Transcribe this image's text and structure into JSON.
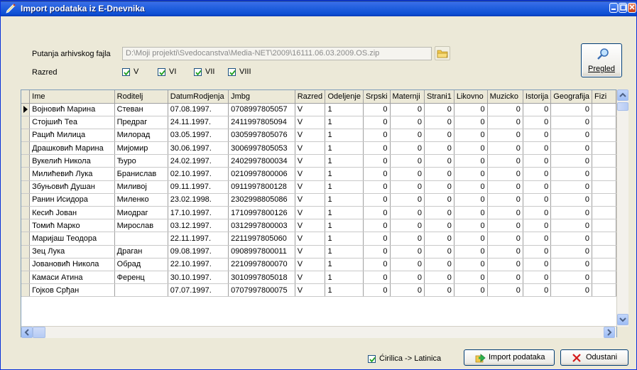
{
  "window": {
    "title": "Import podataka iz E-Dnevnika"
  },
  "form": {
    "path_label": "Putanja arhivskog fajla",
    "path_value": "D:\\Moji projekti\\Svedocanstva\\Media-NET\\2009\\16111.06.03.2009.OS.zip",
    "grade_label": "Razred",
    "grades": [
      {
        "label": "V",
        "checked": true
      },
      {
        "label": "VI",
        "checked": true
      },
      {
        "label": "VII",
        "checked": true
      },
      {
        "label": "VIII",
        "checked": true
      }
    ],
    "preview_label": "Pregled"
  },
  "table": {
    "columns": [
      "Ime",
      "Roditelj",
      "DatumRodjenja",
      "Jmbg",
      "Razred",
      "Odeljenje",
      "Srpski",
      "Maternji",
      "Strani1",
      "Likovno",
      "Muzicko",
      "Istorija",
      "Geografija",
      "Fizi"
    ],
    "rows": [
      [
        "Војновић Марина",
        "Стеван",
        "07.08.1997.",
        "0708997805057",
        "V",
        "1",
        "0",
        "0",
        "0",
        "0",
        "0",
        "0",
        "0",
        ""
      ],
      [
        "Стојшић Теа",
        "Предраг",
        "24.11.1997.",
        "2411997805094",
        "V",
        "1",
        "0",
        "0",
        "0",
        "0",
        "0",
        "0",
        "0",
        ""
      ],
      [
        "Рацић Милица",
        "Милорад",
        "03.05.1997.",
        "0305997805076",
        "V",
        "1",
        "0",
        "0",
        "0",
        "0",
        "0",
        "0",
        "0",
        ""
      ],
      [
        "Драшковић Марина",
        "Мијомир",
        "30.06.1997.",
        "3006997805053",
        "V",
        "1",
        "0",
        "0",
        "0",
        "0",
        "0",
        "0",
        "0",
        ""
      ],
      [
        "Вукелић Никола",
        "Ђуро",
        "24.02.1997.",
        "2402997800034",
        "V",
        "1",
        "0",
        "0",
        "0",
        "0",
        "0",
        "0",
        "0",
        ""
      ],
      [
        "Милићевић Лука",
        "Бранислав",
        "02.10.1997.",
        "0210997800006",
        "V",
        "1",
        "0",
        "0",
        "0",
        "0",
        "0",
        "0",
        "0",
        ""
      ],
      [
        "Збуњовић Душан",
        "Миливој",
        "09.11.1997.",
        "0911997800128",
        "V",
        "1",
        "0",
        "0",
        "0",
        "0",
        "0",
        "0",
        "0",
        ""
      ],
      [
        "Ранин Исидора",
        "Миленко",
        "23.02.1998.",
        "2302998805086",
        "V",
        "1",
        "0",
        "0",
        "0",
        "0",
        "0",
        "0",
        "0",
        ""
      ],
      [
        "Кесић Јован",
        "Миодраг",
        "17.10.1997.",
        "1710997800126",
        "V",
        "1",
        "0",
        "0",
        "0",
        "0",
        "0",
        "0",
        "0",
        ""
      ],
      [
        "Томић Марко",
        "Мирослав",
        "03.12.1997.",
        "0312997800003",
        "V",
        "1",
        "0",
        "0",
        "0",
        "0",
        "0",
        "0",
        "0",
        ""
      ],
      [
        "Маријаш Теодора",
        "",
        "22.11.1997.",
        "2211997805060",
        "V",
        "1",
        "0",
        "0",
        "0",
        "0",
        "0",
        "0",
        "0",
        ""
      ],
      [
        "Зец Лука",
        "Драган",
        "09.08.1997.",
        "0908997800011",
        "V",
        "1",
        "0",
        "0",
        "0",
        "0",
        "0",
        "0",
        "0",
        ""
      ],
      [
        "Јовановић Никола",
        "Обрад",
        "22.10.1997.",
        "2210997800070",
        "V",
        "1",
        "0",
        "0",
        "0",
        "0",
        "0",
        "0",
        "0",
        ""
      ],
      [
        "Камаси Атина",
        "Ференц",
        "30.10.1997.",
        "3010997805018",
        "V",
        "1",
        "0",
        "0",
        "0",
        "0",
        "0",
        "0",
        "0",
        ""
      ],
      [
        "Гојков Срђан",
        "",
        "07.07.1997.",
        "0707997800075",
        "V",
        "1",
        "0",
        "0",
        "0",
        "0",
        "0",
        "0",
        "0",
        ""
      ]
    ]
  },
  "footer": {
    "translit_label": "Ćirilica -> Latinica",
    "translit_checked": true,
    "import_label": "Import podataka",
    "cancel_label": "Odustani"
  },
  "icons": {
    "app": "pen-icon",
    "browse": "folder-icon",
    "preview": "magnifier-icon",
    "import": "import-icon",
    "cancel": "close-x-icon"
  }
}
